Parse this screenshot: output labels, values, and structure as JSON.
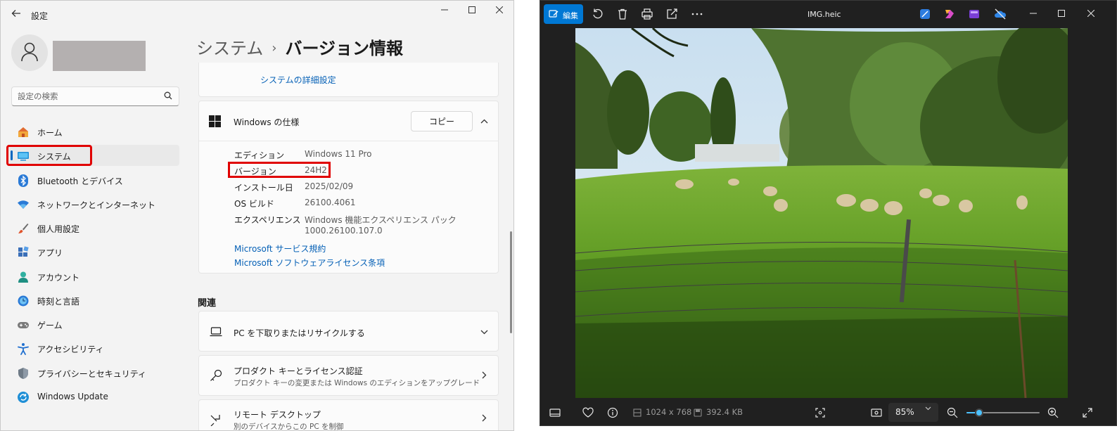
{
  "settings": {
    "app_title": "設定",
    "search_placeholder": "設定の検索",
    "nav": [
      {
        "label": "ホーム"
      },
      {
        "label": "システム"
      },
      {
        "label": "Bluetooth とデバイス"
      },
      {
        "label": "ネットワークとインターネット"
      },
      {
        "label": "個人用設定"
      },
      {
        "label": "アプリ"
      },
      {
        "label": "アカウント"
      },
      {
        "label": "時刻と言語"
      },
      {
        "label": "ゲーム"
      },
      {
        "label": "アクセシビリティ"
      },
      {
        "label": "プライバシーとセキュリティ"
      },
      {
        "label": "Windows Update"
      }
    ],
    "breadcrumb": {
      "parent": "システム",
      "separator": "›",
      "current": "バージョン情報"
    },
    "advanced_link": "システムの詳細設定",
    "windows_spec": {
      "title": "Windows の仕様",
      "copy_label": "コピー",
      "rows": [
        {
          "key": "エディション",
          "value": "Windows 11 Pro"
        },
        {
          "key": "バージョン",
          "value": "24H2"
        },
        {
          "key": "インストール日",
          "value": "2025/02/09"
        },
        {
          "key": "OS ビルド",
          "value": "26100.4061"
        },
        {
          "key": "エクスペリエンス",
          "value": "Windows 機能エクスペリエンス パック",
          "value2": "1000.26100.107.0"
        }
      ],
      "links": [
        "Microsoft サービス規約",
        "Microsoft ソフトウェアライセンス条項"
      ]
    },
    "related": {
      "title": "関連",
      "items": [
        {
          "title": "PC を下取りまたはリサイクルする"
        },
        {
          "title": "プロダクト キーとライセンス認証",
          "subtitle": "プロダクト キーの変更または Windows のエディションをアップグレード"
        },
        {
          "title": "リモート デスクトップ",
          "subtitle": "別のデバイスからこの PC を制御"
        }
      ]
    },
    "accent_color": "#0067c0",
    "highlight_color": "#e00000"
  },
  "photos": {
    "edit_label": "編集",
    "file_title": "IMG.heic",
    "dimensions": "1024 x 768",
    "file_size": "392.4 KB",
    "zoom_label": "85%",
    "zoom_level_fraction": 0.17,
    "accent_color": "#0078d4"
  }
}
